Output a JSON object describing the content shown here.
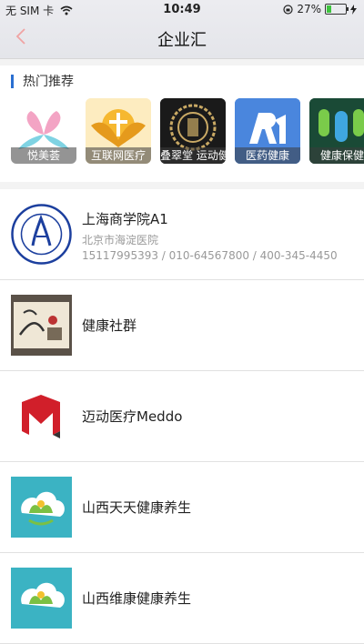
{
  "status_bar": {
    "carrier": "无 SIM 卡",
    "time": "10:49",
    "battery_percent": "27%",
    "battery_level": 0.27
  },
  "nav": {
    "title": "企业汇",
    "back_icon": "chevron-left-icon"
  },
  "hot": {
    "title": "热门推荐",
    "items": [
      {
        "label": "悦美荟"
      },
      {
        "label": "互联网医疗"
      },
      {
        "label": "叠翠堂 运动健"
      },
      {
        "label": "医药健康"
      },
      {
        "label": "健康保健"
      }
    ]
  },
  "list": [
    {
      "name": "上海商学院A1",
      "location": "北京市海淀医院",
      "phones": "15117995393 / 010-64567800 / 400-345-4450"
    },
    {
      "name": "健康社群"
    },
    {
      "name": "迈动医疗Meddo"
    },
    {
      "name": "山西天天健康养生"
    },
    {
      "name": "山西维康健康养生"
    }
  ],
  "colors": {
    "accent": "#2a6fd1",
    "back_arrow": "#f0a3a3"
  }
}
